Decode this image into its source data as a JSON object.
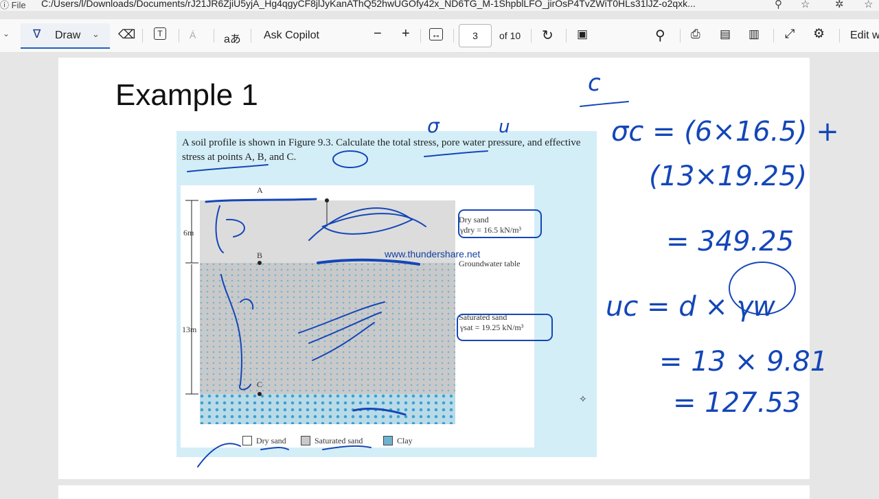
{
  "address_bar": {
    "info_label": "ⓘ File",
    "url": "C:/Users/l/Downloads/Documents/rJ21JR6ZjiU5yjA_Hg4qgyCF8jlJyKanAThQ52hwUGOfy42x_ND6TG_M-1ShpblLFO_jirOsP4TvZWiT0HLs31lJZ-o2qxk..."
  },
  "toolbar": {
    "draw_label": "Draw",
    "ask_copilot": "Ask Copilot",
    "zoom_out": "−",
    "zoom_in": "+",
    "page_current": "3",
    "page_total": "of 10",
    "edit_label": "Edit w",
    "read_aloud_glyph": "Á",
    "translate_glyph": "aあ"
  },
  "document": {
    "title": "Example 1",
    "problem_text": "A soil profile is shown in Figure 9.3. Calculate the total stress, pore water pressure, and effective stress at points A, B, and C.",
    "figure": {
      "point_a": "A",
      "point_b": "B",
      "point_c": "C",
      "dim_dry": "6m",
      "dim_sat": "13m",
      "dry_label": "Dry sand",
      "dry_gamma": "γdry = 16.5 kN/m³",
      "gwt_label": "Groundwater table",
      "sat_label": "Saturated sand",
      "sat_gamma": "γsat = 19.25 kN/m³",
      "watermark": "www.thundershare.net",
      "legend": [
        "Dry sand",
        "Saturated sand",
        "Clay"
      ]
    }
  },
  "annotations": {
    "ink_color": "#1446b8",
    "lines": [
      "c",
      "σc = (6×16.5) +",
      "(13×19.25)",
      "= 349.25",
      "uc = d × γw",
      "= 13 × 9.81",
      "= 127.53"
    ],
    "sigma_mark": "σ",
    "u_mark": "u"
  }
}
